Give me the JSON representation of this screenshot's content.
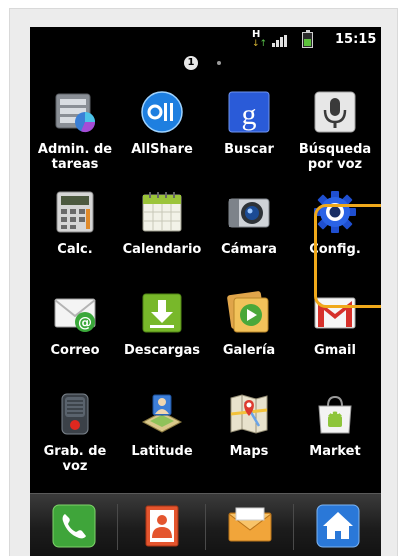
{
  "statusbar": {
    "network_label": "H",
    "time": "15:15",
    "battery_level": 0.6
  },
  "pager": {
    "current_page": "1",
    "page_count": 2
  },
  "apps": [
    {
      "label": "Admin. de\ntareas",
      "icon": "task-manager-icon"
    },
    {
      "label": "AllShare",
      "icon": "allshare-icon"
    },
    {
      "label": "Buscar",
      "icon": "google-search-icon",
      "glyph": "g"
    },
    {
      "label": "Búsqueda\npor voz",
      "icon": "voice-search-icon"
    },
    {
      "label": "Calc.",
      "icon": "calculator-icon"
    },
    {
      "label": "Calendario",
      "icon": "calendar-icon"
    },
    {
      "label": "Cámara",
      "icon": "camera-icon"
    },
    {
      "label": "Config.",
      "icon": "settings-gear-icon",
      "highlighted": true
    },
    {
      "label": "Correo",
      "icon": "email-icon",
      "glyph": "@"
    },
    {
      "label": "Descargas",
      "icon": "downloads-icon"
    },
    {
      "label": "Galería",
      "icon": "gallery-icon"
    },
    {
      "label": "Gmail",
      "icon": "gmail-icon"
    },
    {
      "label": "Grab. de\nvoz",
      "icon": "voice-recorder-icon"
    },
    {
      "label": "Latitude",
      "icon": "latitude-icon"
    },
    {
      "label": "Maps",
      "icon": "maps-icon"
    },
    {
      "label": "Market",
      "icon": "market-icon"
    }
  ],
  "dock": [
    {
      "name": "phone",
      "icon": "phone-icon"
    },
    {
      "name": "contacts",
      "icon": "contacts-icon"
    },
    {
      "name": "messaging",
      "icon": "messaging-icon"
    },
    {
      "name": "home",
      "icon": "home-icon"
    }
  ],
  "colors": {
    "highlight": "#f0a91b",
    "screen_background": "#000000",
    "frame_background": "#ececec"
  }
}
